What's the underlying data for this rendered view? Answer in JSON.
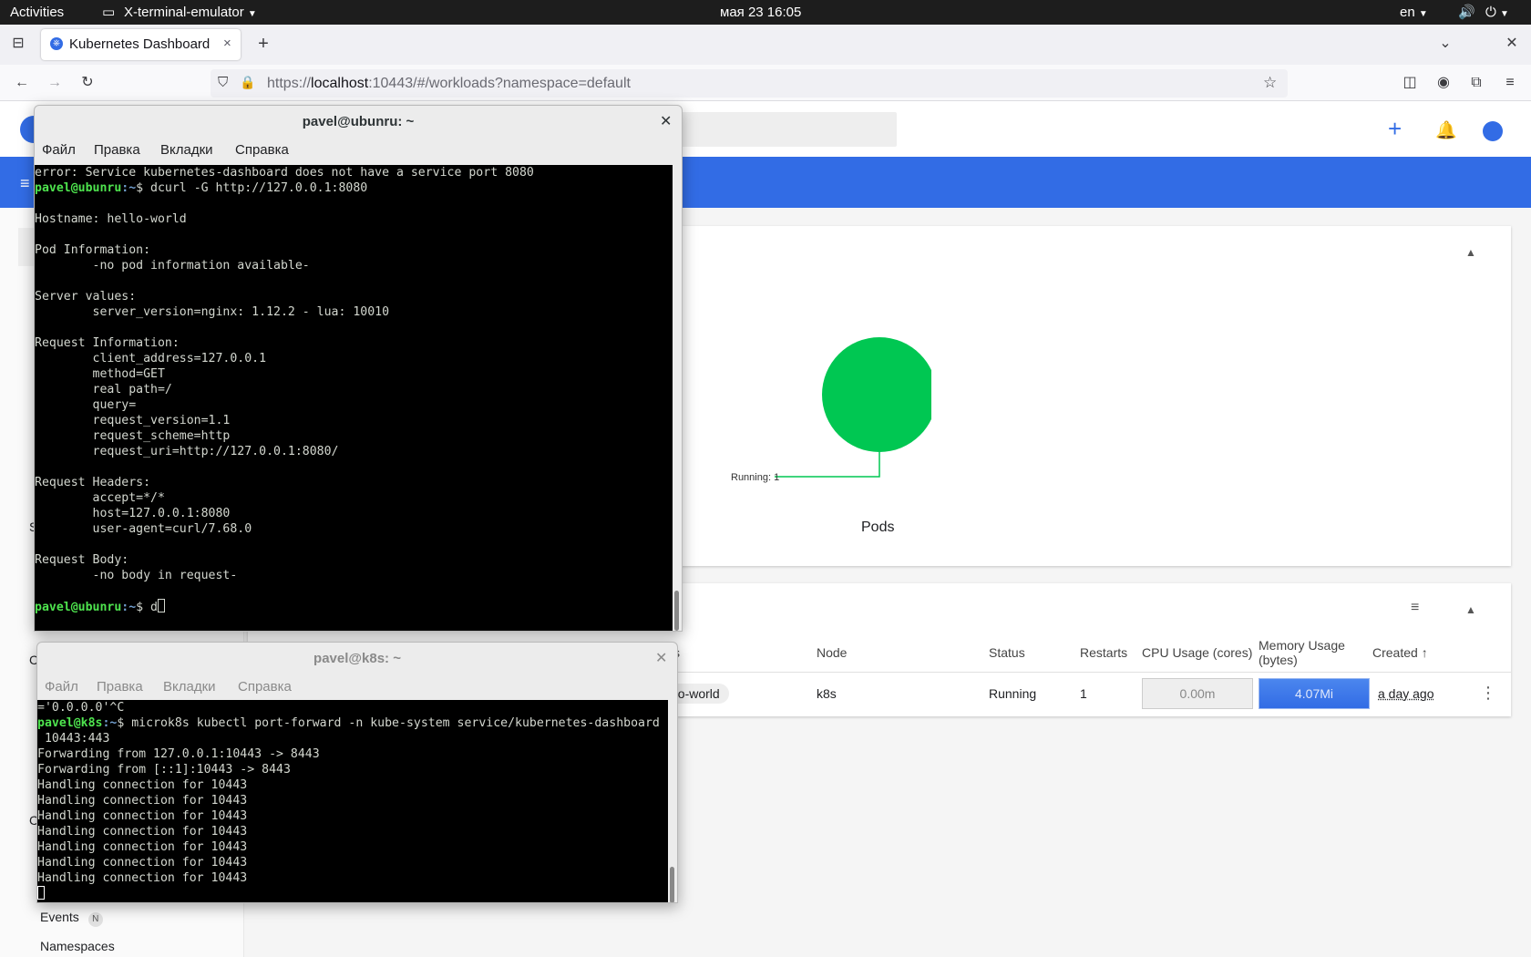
{
  "topbar": {
    "activities": "Activities",
    "app_name": "X-terminal-emulator",
    "clock": "мая 23  16:05",
    "lang": "en"
  },
  "browser": {
    "tab_title": "Kubernetes Dashboard",
    "url_prefix": "https://",
    "url_host": "localhost",
    "url_rest": ":10443/#/workloads?namespace=default"
  },
  "dashboard": {
    "chart_data": {
      "type": "pie",
      "title": "Pods",
      "slices": [
        {
          "label": "Running: 1",
          "value": 1,
          "color": "#00c752"
        }
      ]
    },
    "table": {
      "headers": [
        "s",
        "Node",
        "Status",
        "Restarts",
        "CPU Usage (cores)",
        "Memory Usage",
        "(bytes)",
        "Created"
      ],
      "row": {
        "name": "hello-world",
        "node": "k8s",
        "status": "Running",
        "restarts": "1",
        "cpu": "0.00m",
        "memory": "4.07Mi",
        "created": "a day ago"
      }
    },
    "sidebar": {
      "events": "Events",
      "events_badge": "N",
      "namespaces": "Namespaces",
      "frag_s": "S",
      "frag_c1": "C",
      "frag_c2": "C"
    }
  },
  "term1": {
    "title": "pavel@ubunru: ~",
    "menu": [
      "Файл",
      "Правка",
      "Вкладки",
      "Справка"
    ],
    "line_error": "error: Service kubernetes-dashboard does not have a service port 8080",
    "prompt_user": "pavel@ubunru",
    "prompt_path": ":~",
    "cmd1": "$ dcurl -G http://127.0.0.1:8080",
    "output": "\n\nHostname: hello-world\n\nPod Information:\n        -no pod information available-\n\nServer values:\n        server_version=nginx: 1.12.2 - lua: 10010\n\nRequest Information:\n        client_address=127.0.0.1\n        method=GET\n        real path=/\n        query=\n        request_version=1.1\n        request_scheme=http\n        request_uri=http://127.0.0.1:8080/\n\nRequest Headers:\n        accept=*/*\n        host=127.0.0.1:8080\n        user-agent=curl/7.68.0\n\nRequest Body:\n        -no body in request-\n",
    "cmd2": "$ d"
  },
  "term2": {
    "title": "pavel@k8s: ~",
    "menu": [
      "Файл",
      "Правка",
      "Вкладки",
      "Справка"
    ],
    "line0": "='0.0.0.0'^C",
    "prompt_user": "pavel@k8s",
    "prompt_path": ":~",
    "cmd1": "$ microk8s kubectl port-forward -n kube-system service/kubernetes-dashboard",
    "output": " 10443:443\nForwarding from 127.0.0.1:10443 -> 8443\nForwarding from [::1]:10443 -> 8443\nHandling connection for 10443\nHandling connection for 10443\nHandling connection for 10443\nHandling connection for 10443\nHandling connection for 10443\nHandling connection for 10443\nHandling connection for 10443"
  }
}
